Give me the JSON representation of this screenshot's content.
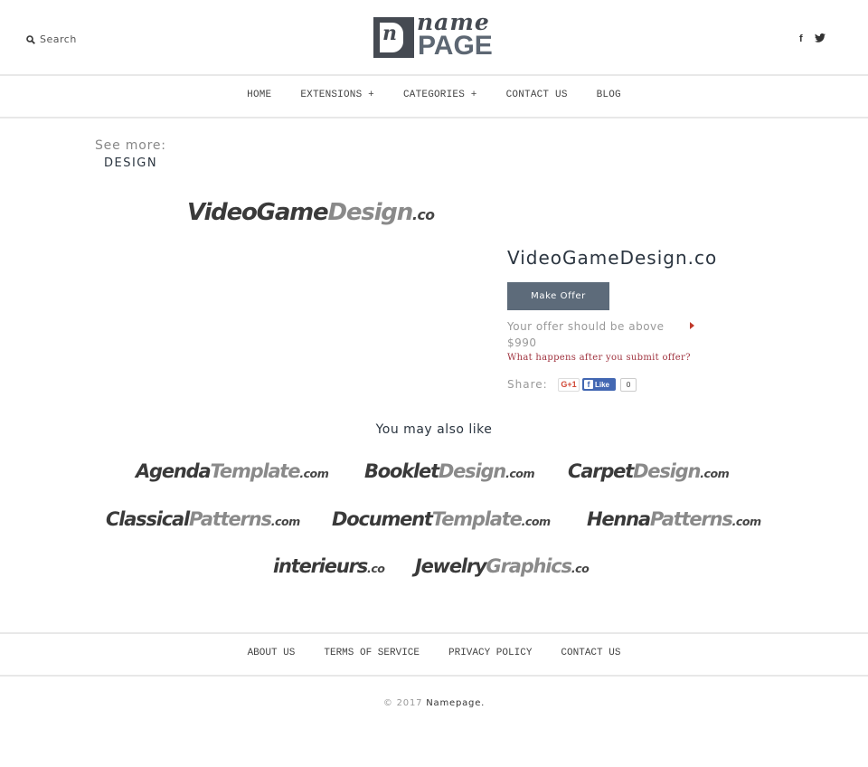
{
  "header": {
    "search_label": "Search",
    "logo": {
      "top": "name",
      "bottom": "PAGE",
      "mark": "n"
    },
    "social": {
      "facebook": "f"
    }
  },
  "nav": {
    "items": [
      {
        "label": "HOME"
      },
      {
        "label": "EXTENSIONS +"
      },
      {
        "label": "CATEGORIES +"
      },
      {
        "label": "CONTACT US"
      },
      {
        "label": "BLOG"
      }
    ]
  },
  "see_more": {
    "label": "See more:",
    "category": "DESIGN"
  },
  "domain": {
    "logo_part1": "VideoGame",
    "logo_part2": "Design",
    "logo_tld": ".co",
    "title": "VideoGameDesign.co",
    "make_offer_label": "Make Offer",
    "offer_note": "Your offer should be above $990",
    "what_happens_link": "What happens after you submit offer?",
    "share_label": "Share:",
    "gplus_label": "G+1",
    "fb_like_label": "Like",
    "fb_like_count": "0"
  },
  "related": {
    "title": "You may also like",
    "items": [
      {
        "p1": "Agenda",
        "p2": "Template",
        "tld": ".com"
      },
      {
        "p1": "Booklet",
        "p2": "Design",
        "tld": ".com"
      },
      {
        "p1": "Carpet",
        "p2": "Design",
        "tld": ".com"
      },
      {
        "p1": "Classical",
        "p2": "Patterns",
        "tld": ".com"
      },
      {
        "p1": "Document",
        "p2": "Template",
        "tld": ".com"
      },
      {
        "p1": "Henna",
        "p2": "Patterns",
        "tld": ".com"
      },
      {
        "p1": "interieurs",
        "p2": "",
        "tld": ".co"
      },
      {
        "p1": "Jewelry",
        "p2": "Graphics",
        "tld": ".co"
      }
    ]
  },
  "footer": {
    "links": [
      {
        "label": "ABOUT US"
      },
      {
        "label": "TERMS OF SERVICE"
      },
      {
        "label": "PRIVACY POLICY"
      },
      {
        "label": "CONTACT US"
      }
    ],
    "copyright": "© 2017",
    "brand": "Namepage."
  }
}
